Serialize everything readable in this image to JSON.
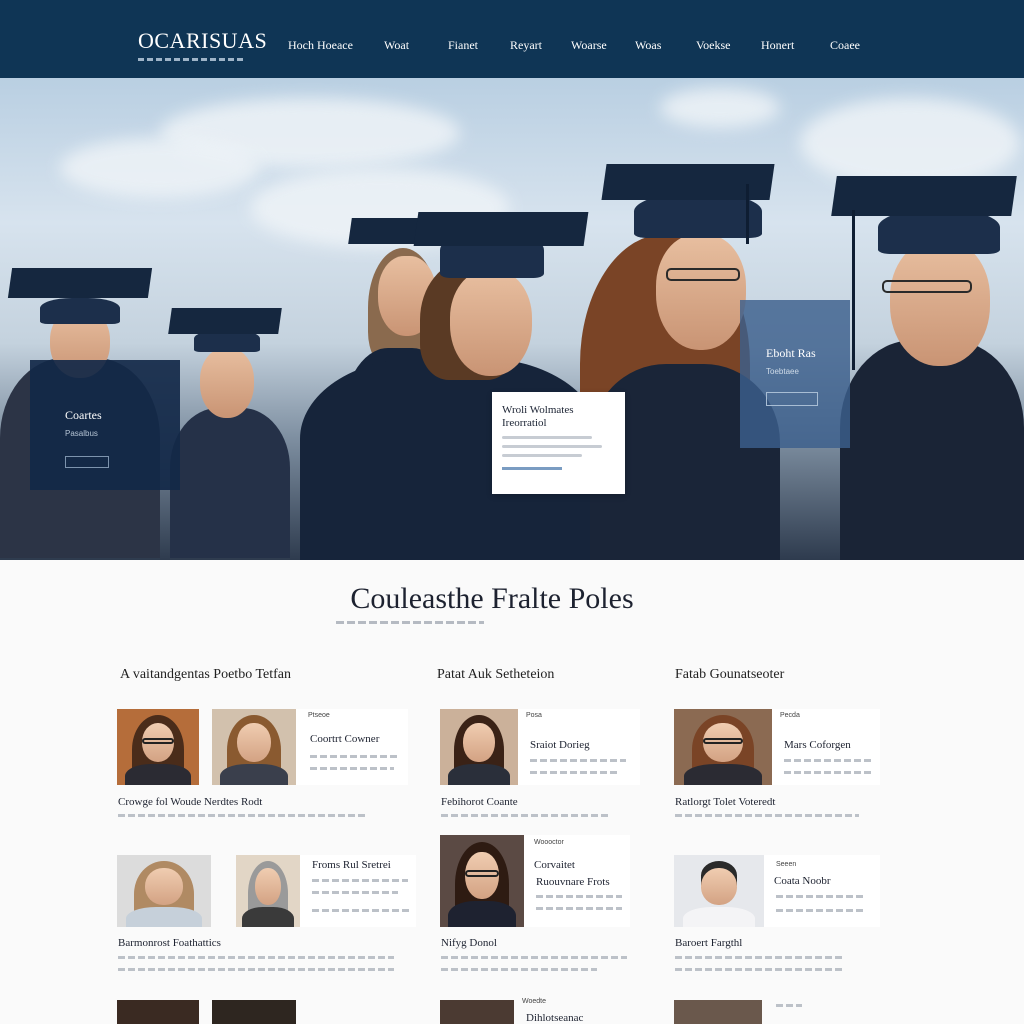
{
  "nav": {
    "logo": "OCARISUAS",
    "items": [
      "Hoch Hoeace",
      "Woat",
      "Fianet",
      "Reyart",
      "Woarse",
      "Woas",
      "Voekse",
      "Honert",
      "Coaee"
    ]
  },
  "hero": {
    "card_left": {
      "title": "Coartes",
      "subtitle": "Pasalbus"
    },
    "card_center": {
      "title": "Wroli Wolmates",
      "subtitle": "Ireorratiol"
    },
    "card_right": {
      "title": "Eboht Ras",
      "subtitle": "Toebtaee"
    }
  },
  "section": {
    "title": "Couleasthe Fralte Poles"
  },
  "columns": [
    {
      "title": "A vaitandgentas Poetbo Tetfan",
      "cards": [
        {
          "label": "Ptseoe",
          "name": "Coortrt Cowner"
        },
        {
          "name": "Froms Rul Sretrei"
        }
      ],
      "rows": [
        "Crowge fol Woude Nerdtes Rodt",
        "Barmonrost Foathattics"
      ]
    },
    {
      "title": "Patat Auk Setheteion",
      "cards": [
        {
          "label": "Posa",
          "name": "Sraiot Dorieg"
        },
        {
          "label": "Woooctor",
          "name": "Corvaitet",
          "name2": "Ruouvnare Frots"
        }
      ],
      "rows": [
        "Febihorot Coante",
        "Nifyg Donol"
      ]
    },
    {
      "title": "Fatab Gounatseoter",
      "cards": [
        {
          "label": "Pecda",
          "name": "Mars Coforgen"
        },
        {
          "label": "Seeen",
          "name": "Coata Noobr"
        }
      ],
      "rows": [
        "Ratlorgt Tolet Voteredt",
        "Baroert Fargthl"
      ]
    },
    {
      "footer_label": "Woedte",
      "footer_name": "Dihlotseanac"
    }
  ],
  "colors": {
    "nav_bg": "#0f3555",
    "accent": "#7a9cc2"
  }
}
